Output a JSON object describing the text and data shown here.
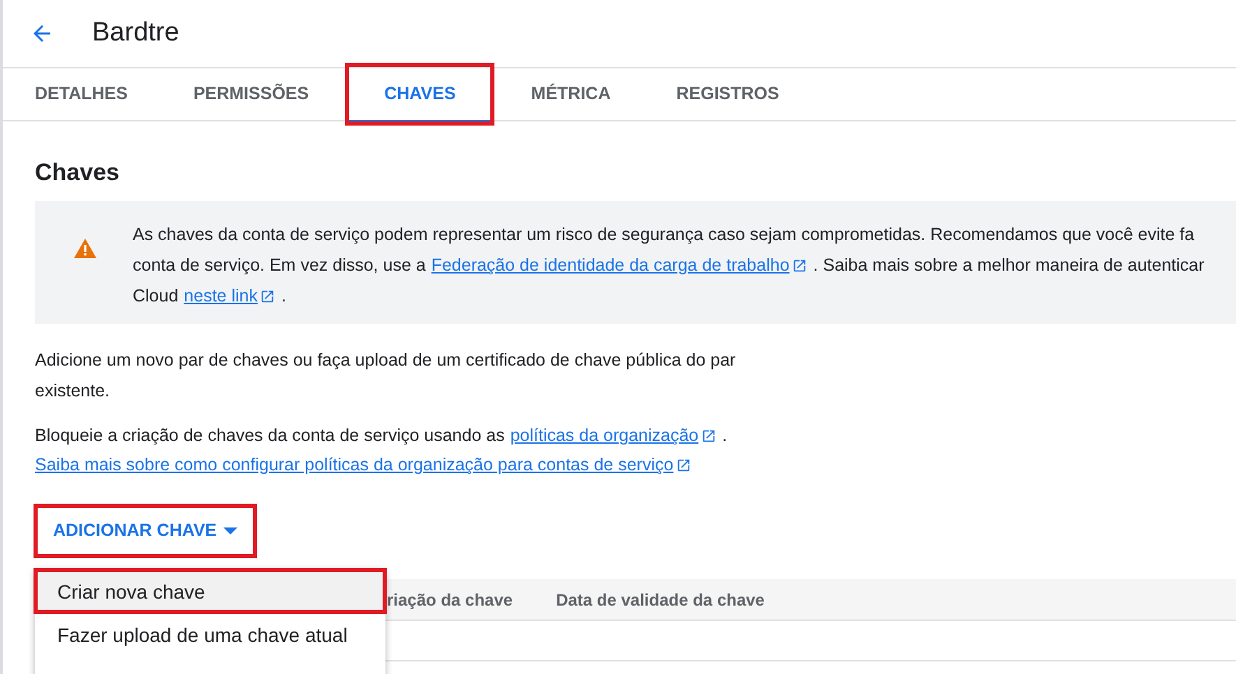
{
  "header": {
    "title": "Bardtre"
  },
  "tabs": [
    {
      "label": "DETALHES",
      "selected": false,
      "highlighted": false
    },
    {
      "label": "PERMISSÕES",
      "selected": false,
      "highlighted": false
    },
    {
      "label": "CHAVES",
      "selected": true,
      "highlighted": true
    },
    {
      "label": "MÉTRICA",
      "selected": false,
      "highlighted": false
    },
    {
      "label": "REGISTROS",
      "selected": false,
      "highlighted": false
    }
  ],
  "section_title": "Chaves",
  "warning": {
    "lines": [
      [
        {
          "kind": "text",
          "text": "As chaves da conta de serviço podem representar um risco de segurança caso sejam comprometidas. Recomendamos que você evite fa"
        }
      ],
      [
        {
          "kind": "text",
          "text": "conta de serviço. Em vez disso, use a"
        },
        {
          "kind": "link",
          "text": "Federação de identidade da carga de trabalho"
        },
        {
          "kind": "text",
          "text": ". Saiba mais sobre a melhor maneira de autenticar"
        }
      ],
      [
        {
          "kind": "text",
          "text": "Cloud"
        },
        {
          "kind": "link",
          "text": "neste link"
        },
        {
          "kind": "text",
          "text": "."
        }
      ]
    ]
  },
  "description": "Adicione um novo par de chaves ou faça upload de um certificado de chave pública do par existente.",
  "policy": [
    [
      {
        "kind": "text",
        "text": "Bloqueie a criação de chaves da conta de serviço usando as"
      },
      {
        "kind": "link",
        "text": "políticas da organização"
      },
      {
        "kind": "text",
        "text": "."
      }
    ],
    [
      {
        "kind": "link",
        "text": "Saiba mais sobre como configurar políticas da organização para contas de serviço"
      }
    ]
  ],
  "add_button": {
    "label": "ADICIONAR CHAVE",
    "highlighted": true
  },
  "menu": {
    "items": [
      {
        "label": "Criar nova chave",
        "selected": true,
        "highlighted": true
      },
      {
        "label": "Fazer upload de uma chave atual",
        "selected": false,
        "highlighted": false
      }
    ]
  },
  "table": {
    "columns": [
      "riação da chave",
      "Data de validade da chave"
    ]
  }
}
